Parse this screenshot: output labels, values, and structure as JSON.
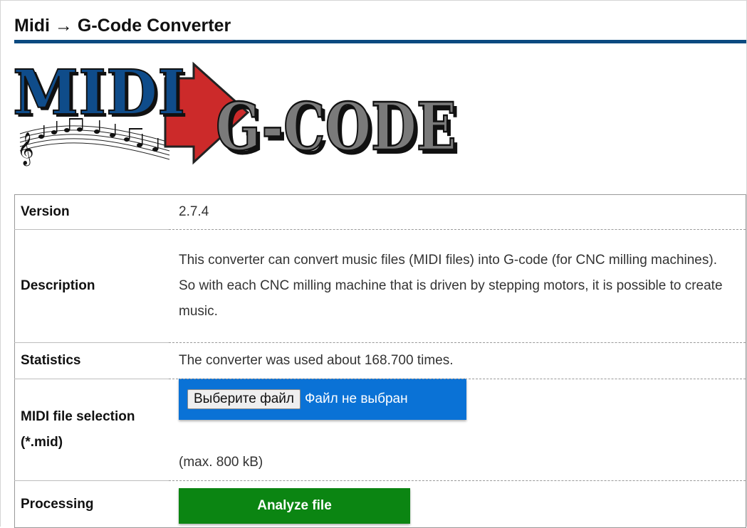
{
  "header": {
    "title": "Midi → G-Code Converter"
  },
  "logo": {
    "text_left": "MIDI",
    "text_right": "G-CODE"
  },
  "table": {
    "version": {
      "label": "Version",
      "value": "2.7.4"
    },
    "description": {
      "label": "Description",
      "line1": "This converter can convert music files (MIDI files) into G-code (for CNC milling machines).",
      "line2": "So with each CNC milling machine that is driven by stepping motors, it is possible to create music."
    },
    "statistics": {
      "label": "Statistics",
      "value": "The converter was used about 168.700 times."
    },
    "midi": {
      "label": "MIDI file selection (*.mid)",
      "button": "Выберите файл",
      "status": "Файл не выбран",
      "note": "(max. 800 kB)"
    },
    "processing": {
      "label": "Processing",
      "button": "Analyze file"
    }
  },
  "colors": {
    "accent": "#0b4a80",
    "file_box": "#0a72d6",
    "analyze_button": "#0b8512",
    "arrow": "#cc2a2a",
    "logo_blue": "#0f4c8a",
    "logo_gray": "#7a7a7a"
  }
}
